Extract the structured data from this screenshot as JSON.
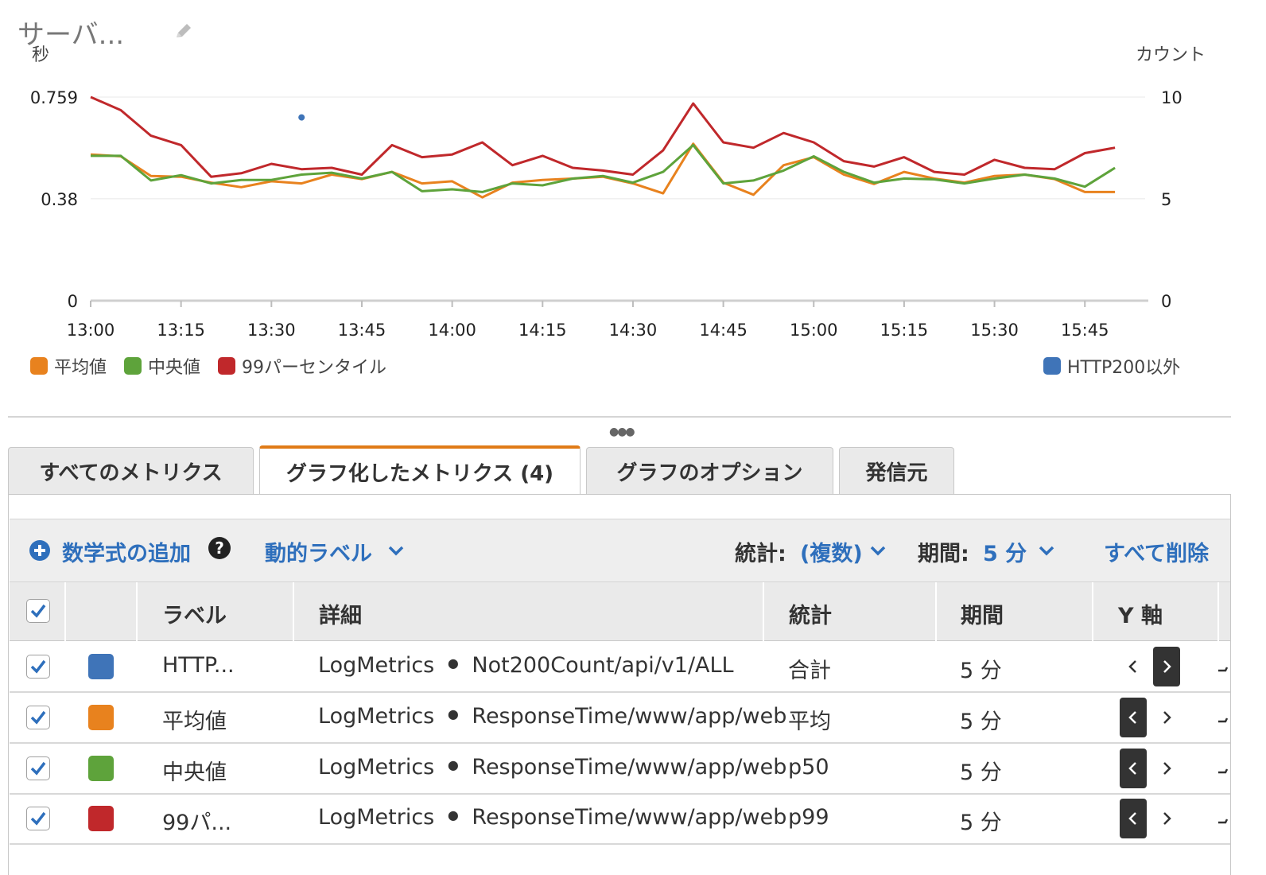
{
  "widget": {
    "title": "サーバ..."
  },
  "chart_data": {
    "type": "line",
    "left_axis": {
      "label": "秒",
      "ticks": [
        "0.759",
        "0.38",
        "0"
      ],
      "ylim": [
        0,
        0.759
      ]
    },
    "right_axis": {
      "label": "カウント",
      "ticks": [
        "10",
        "5",
        "0"
      ],
      "ylim": [
        0,
        10
      ]
    },
    "x_ticks": [
      "13:00",
      "13:15",
      "13:30",
      "13:45",
      "14:00",
      "14:15",
      "14:30",
      "14:45",
      "15:00",
      "15:15",
      "15:30",
      "15:45"
    ],
    "x_start_minutes": 780,
    "x_end_minutes": 955,
    "grid": "horizontal",
    "legend_left": [
      "平均値",
      "中央値",
      "99パーセンタイル"
    ],
    "legend_right": [
      "HTTP200以外"
    ],
    "series": [
      {
        "name": "平均値",
        "color": "#e8821e",
        "axis": "left",
        "x": [
          780,
          785,
          790,
          795,
          800,
          805,
          810,
          815,
          820,
          825,
          830,
          835,
          840,
          845,
          850,
          855,
          860,
          865,
          870,
          875,
          880,
          885,
          890,
          895,
          900,
          905,
          910,
          915,
          920,
          925,
          930,
          935,
          940,
          945,
          950
        ],
        "y": [
          0.545,
          0.538,
          0.465,
          0.462,
          0.44,
          0.423,
          0.445,
          0.437,
          0.47,
          0.453,
          0.48,
          0.437,
          0.445,
          0.385,
          0.44,
          0.45,
          0.455,
          0.462,
          0.437,
          0.4,
          0.585,
          0.44,
          0.395,
          0.505,
          0.535,
          0.47,
          0.435,
          0.48,
          0.455,
          0.44,
          0.465,
          0.47,
          0.453,
          0.405,
          0.405
        ]
      },
      {
        "name": "中央値",
        "color": "#5ea33b",
        "axis": "left",
        "x": [
          780,
          785,
          790,
          795,
          800,
          805,
          810,
          815,
          820,
          825,
          830,
          835,
          840,
          845,
          850,
          855,
          860,
          865,
          870,
          875,
          880,
          885,
          890,
          895,
          900,
          905,
          910,
          915,
          920,
          925,
          930,
          935,
          940,
          945,
          950
        ],
        "y": [
          0.54,
          0.54,
          0.448,
          0.468,
          0.437,
          0.45,
          0.45,
          0.47,
          0.477,
          0.455,
          0.48,
          0.408,
          0.415,
          0.405,
          0.437,
          0.43,
          0.455,
          0.465,
          0.44,
          0.48,
          0.58,
          0.437,
          0.448,
          0.485,
          0.538,
          0.48,
          0.44,
          0.455,
          0.452,
          0.437,
          0.455,
          0.47,
          0.455,
          0.425,
          0.495
        ]
      },
      {
        "name": "99パーセンタイル",
        "color": "#c0282b",
        "axis": "left",
        "x": [
          780,
          785,
          790,
          795,
          800,
          805,
          810,
          815,
          820,
          825,
          830,
          835,
          840,
          845,
          850,
          855,
          860,
          865,
          870,
          875,
          880,
          885,
          890,
          895,
          900,
          905,
          910,
          915,
          920,
          925,
          930,
          935,
          940,
          945,
          950
        ],
        "y": [
          0.759,
          0.71,
          0.615,
          0.58,
          0.462,
          0.475,
          0.51,
          0.49,
          0.495,
          0.47,
          0.58,
          0.535,
          0.545,
          0.59,
          0.505,
          0.54,
          0.495,
          0.485,
          0.47,
          0.56,
          0.735,
          0.59,
          0.57,
          0.625,
          0.59,
          0.52,
          0.5,
          0.535,
          0.48,
          0.47,
          0.525,
          0.495,
          0.49,
          0.55,
          0.57
        ]
      },
      {
        "name": "HTTP200以外",
        "color": "#3f74b8",
        "axis": "right",
        "x": [
          815
        ],
        "y": [
          9
        ]
      }
    ]
  },
  "tabs": [
    {
      "label": "すべてのメトリクス"
    },
    {
      "label": "グラフ化したメトリクス (4)"
    },
    {
      "label": "グラフのオプション"
    },
    {
      "label": "発信元"
    }
  ],
  "toolbar": {
    "add_math": "数学式の追加",
    "help": "?",
    "dynamic_label": "動的ラベル",
    "stat_label": "統計:",
    "stat_value": "(複数)",
    "period_label": "期間:",
    "period_value": "5 分",
    "delete_all": "すべて削除"
  },
  "table": {
    "headers": {
      "label": "ラベル",
      "details": "詳細",
      "stat": "統計",
      "period": "期間",
      "yaxis": "Y 軸"
    },
    "rows": [
      {
        "color": "#3f74b8",
        "label": "HTTP...",
        "namespace": "LogMetrics",
        "metric": "Not200Count/api/v1/ALL",
        "stat": "合計",
        "period": "5 分",
        "yaxis": "right"
      },
      {
        "color": "#e8821e",
        "label": "平均値",
        "namespace": "LogMetrics",
        "metric": "ResponseTime/www/app/web",
        "stat": "平均",
        "period": "5 分",
        "yaxis": "left"
      },
      {
        "color": "#5ea33b",
        "label": "中央値",
        "namespace": "LogMetrics",
        "metric": "ResponseTime/www/app/web",
        "stat": "p50",
        "period": "5 分",
        "yaxis": "left"
      },
      {
        "color": "#c0282b",
        "label": "99パ...",
        "namespace": "LogMetrics",
        "metric": "ResponseTime/www/app/web",
        "stat": "p99",
        "period": "5 分",
        "yaxis": "left"
      }
    ]
  },
  "icons": {
    "pencil": "pencil-icon",
    "plus": "plus-circle-icon",
    "help": "help-circle-icon",
    "chevron": "chevron-down-icon",
    "check": "checkmark-icon"
  }
}
